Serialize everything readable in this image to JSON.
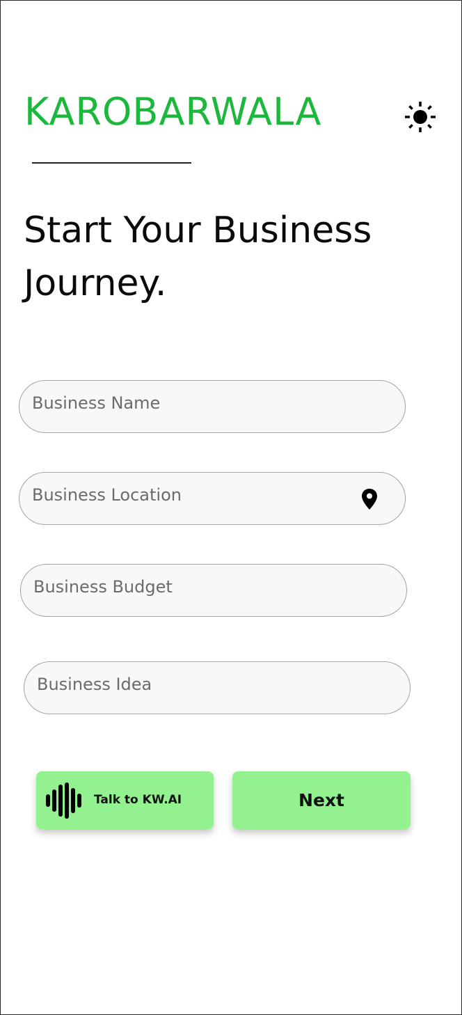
{
  "header": {
    "brand": "KAROBARWALA",
    "theme_icon": "sun-icon"
  },
  "hero": {
    "title": "Start Your Business Journey."
  },
  "form": {
    "business_name": {
      "placeholder": "Business Name",
      "value": ""
    },
    "business_location": {
      "placeholder": "Business Location",
      "value": "",
      "icon": "location-pin-icon"
    },
    "business_budget": {
      "placeholder": "Business Budget",
      "value": ""
    },
    "business_idea": {
      "placeholder": "Business Idea",
      "value": ""
    }
  },
  "actions": {
    "talk_label": "Talk to KW.AI",
    "talk_icon": "sound-wave-icon",
    "next_label": "Next"
  },
  "colors": {
    "brand": "#1cb83c",
    "button_bg": "#93f18f",
    "field_bg": "#f8f8f8",
    "field_border": "#a3a3a3"
  }
}
